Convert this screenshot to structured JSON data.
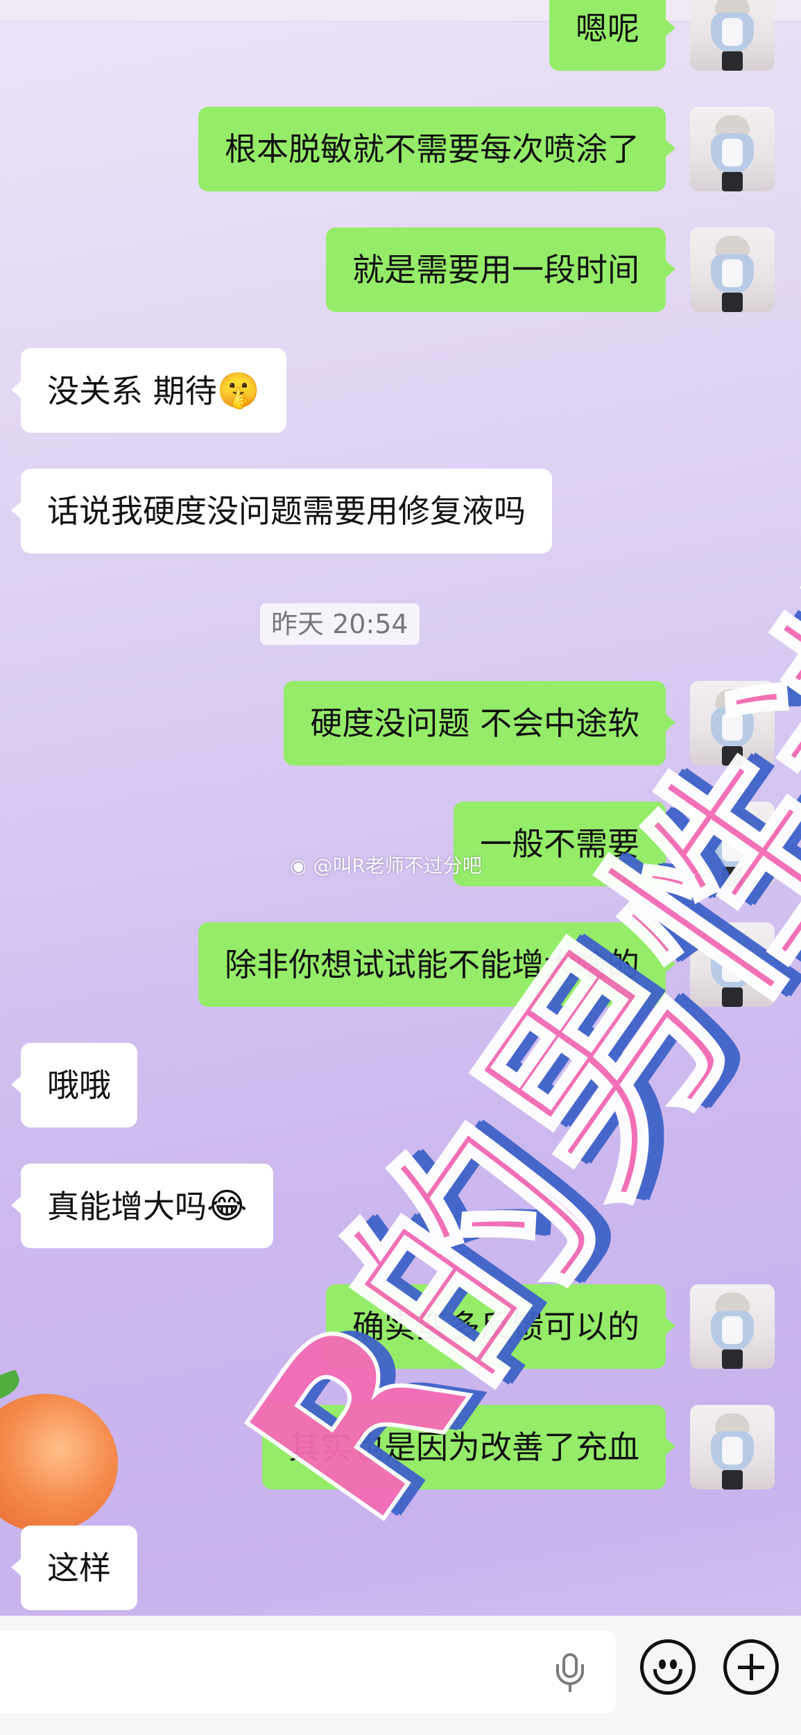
{
  "watermarks": {
    "weibo": "@叫R老师不过分吧",
    "big_text": "R的男性进"
  },
  "timestamp": "昨天 20:54",
  "messages": [
    {
      "side": "me",
      "text": "嗯呢"
    },
    {
      "side": "me",
      "text": "根本脱敏就不需要每次喷涂了"
    },
    {
      "side": "me",
      "text": "就是需要用一段时间"
    },
    {
      "side": "them",
      "text": "没关系 期待",
      "emoji": "🤫"
    },
    {
      "side": "them",
      "text": "话说我硬度没问题需要用修复液吗"
    },
    {
      "side": "me",
      "text": "硬度没问题 不会中途软"
    },
    {
      "side": "me",
      "text": "一般不需要"
    },
    {
      "side": "me",
      "text": "除非你想试试能不能增大啥的"
    },
    {
      "side": "them",
      "text": "哦哦"
    },
    {
      "side": "them",
      "text": "真能增大吗",
      "emoji": "😂"
    },
    {
      "side": "me",
      "text": "确实蛮多反馈可以的"
    },
    {
      "side": "me",
      "text": "其实也是因为改善了充血"
    },
    {
      "side": "them",
      "text": "这样"
    }
  ],
  "input_bar": {
    "icons": [
      "microphone-icon",
      "emoji-icon",
      "plus-icon"
    ]
  },
  "colors": {
    "my_bubble": "#95ec69",
    "their_bubble": "#ffffff",
    "watermark_pink": "#f46cb4",
    "watermark_blue": "#3f63c9"
  }
}
